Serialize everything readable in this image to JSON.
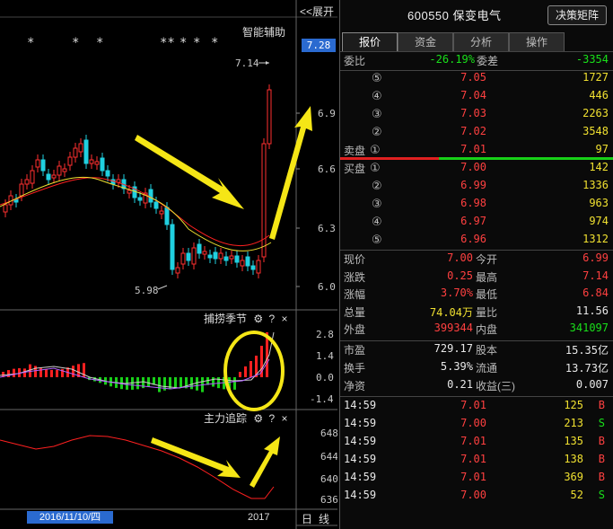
{
  "chart": {
    "expand_label": "<<展开",
    "ai_assist_label": "智能辅助",
    "current_price_tag": "7.28",
    "price_axis": [
      "6.9",
      "6.6",
      "6.3",
      "6.0"
    ],
    "high_marker": "7.14",
    "low_marker": "5.98",
    "star_marks": [
      "*",
      "*",
      "*",
      "**",
      "*",
      "*",
      "*"
    ],
    "indicator1_title": "捕捞季节",
    "indicator1_axis": [
      "2.8",
      "1.4",
      "0.0",
      "-1.4"
    ],
    "indicator2_title": "主力追踪",
    "indicator2_axis": [
      "648",
      "644",
      "640",
      "636"
    ],
    "date_tag": "2016/11/10/四",
    "year_label": "2017",
    "period_day": "日",
    "period_line": "线",
    "gear_icon": "gear-icon",
    "help_icon": "?",
    "close_icon": "×"
  },
  "quote": {
    "code_name": "600550 保变电气",
    "decision_button": "决策矩阵",
    "tabs": [
      "报价",
      "资金",
      "分析",
      "操作"
    ],
    "weibi_label": "委比",
    "weibi_value": "-26.19%",
    "weicha_label": "委差",
    "weicha_value": "-3354",
    "sell_label": "卖盘",
    "buy_label": "买盘",
    "sells": [
      {
        "level": "⑤",
        "price": "7.05",
        "vol": "1727"
      },
      {
        "level": "④",
        "price": "7.04",
        "vol": "446"
      },
      {
        "level": "③",
        "price": "7.03",
        "vol": "2263"
      },
      {
        "level": "②",
        "price": "7.02",
        "vol": "3548"
      },
      {
        "level": "①",
        "price": "7.01",
        "vol": "97"
      }
    ],
    "buys": [
      {
        "level": "①",
        "price": "7.00",
        "vol": "142"
      },
      {
        "level": "②",
        "price": "6.99",
        "vol": "1336"
      },
      {
        "level": "③",
        "price": "6.98",
        "vol": "963"
      },
      {
        "level": "④",
        "price": "6.97",
        "vol": "974"
      },
      {
        "level": "⑤",
        "price": "6.96",
        "vol": "1312"
      }
    ],
    "stats": [
      {
        "l1": "现价",
        "v1": "7.00",
        "c1": "red",
        "l2": "今开",
        "v2": "6.99",
        "c2": "red"
      },
      {
        "l1": "涨跌",
        "v1": "0.25",
        "c1": "red",
        "l2": "最高",
        "v2": "7.14",
        "c2": "red"
      },
      {
        "l1": "涨幅",
        "v1": "3.70%",
        "c1": "red",
        "l2": "最低",
        "v2": "6.84",
        "c2": "red"
      },
      {
        "l1": "总量",
        "v1": "74.04万",
        "c1": "yellow",
        "l2": "量比",
        "v2": "11.56",
        "c2": "white"
      },
      {
        "l1": "外盘",
        "v1": "399344",
        "c1": "red",
        "l2": "内盘",
        "v2": "341097",
        "c2": "green"
      }
    ],
    "stats2": [
      {
        "l1": "市盈",
        "v1": "729.17",
        "l2": "股本",
        "v2": "15.35亿"
      },
      {
        "l1": "换手",
        "v1": "5.39%",
        "l2": "流通",
        "v2": "13.73亿"
      },
      {
        "l1": "净资",
        "v1": "0.21",
        "l2": "收益(三)",
        "v2": "0.007"
      }
    ],
    "ticks": [
      {
        "time": "14:59",
        "price": "7.01",
        "vol": "125",
        "side": "B"
      },
      {
        "time": "14:59",
        "price": "7.00",
        "vol": "213",
        "side": "S"
      },
      {
        "time": "14:59",
        "price": "7.01",
        "vol": "135",
        "side": "B"
      },
      {
        "time": "14:59",
        "price": "7.01",
        "vol": "138",
        "side": "B"
      },
      {
        "time": "14:59",
        "price": "7.01",
        "vol": "369",
        "side": "B"
      },
      {
        "time": "14:59",
        "price": "7.00",
        "vol": "52",
        "side": "S"
      }
    ]
  }
}
